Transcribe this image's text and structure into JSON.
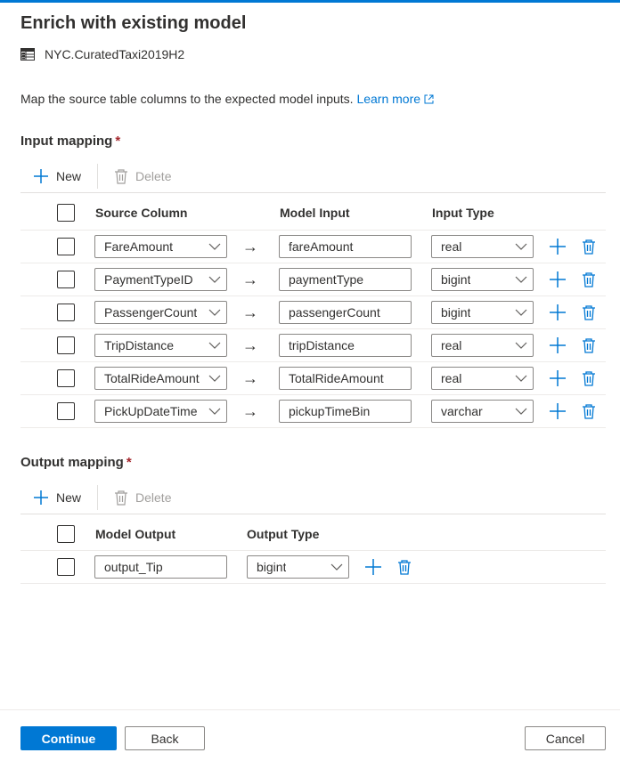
{
  "title": "Enrich with existing model",
  "table_name": "NYC.CuratedTaxi2019H2",
  "description": "Map the source table columns to the expected model inputs.",
  "learn_more": "Learn more",
  "input_mapping": {
    "label": "Input mapping",
    "required_mark": "*",
    "new_label": "New",
    "delete_label": "Delete",
    "headers": {
      "source": "Source Column",
      "model_input": "Model Input",
      "input_type": "Input Type"
    },
    "rows": [
      {
        "source": "FareAmount",
        "model_input": "fareAmount",
        "type": "real"
      },
      {
        "source": "PaymentTypeID",
        "model_input": "paymentType",
        "type": "bigint"
      },
      {
        "source": "PassengerCount",
        "model_input": "passengerCount",
        "type": "bigint"
      },
      {
        "source": "TripDistance",
        "model_input": "tripDistance",
        "type": "real"
      },
      {
        "source": "TotalRideAmount",
        "model_input": "TotalRideAmount",
        "type": "real"
      },
      {
        "source": "PickUpDateTime",
        "model_input": "pickupTimeBin",
        "type": "varchar"
      }
    ],
    "arrow": "→"
  },
  "output_mapping": {
    "label": "Output mapping",
    "required_mark": "*",
    "new_label": "New",
    "delete_label": "Delete",
    "headers": {
      "model_output": "Model Output",
      "output_type": "Output Type"
    },
    "rows": [
      {
        "model_output": "output_Tip",
        "type": "bigint"
      }
    ]
  },
  "buttons": {
    "continue": "Continue",
    "back": "Back",
    "cancel": "Cancel"
  },
  "colors": {
    "accent": "#0078d4",
    "required": "#a4262c"
  }
}
